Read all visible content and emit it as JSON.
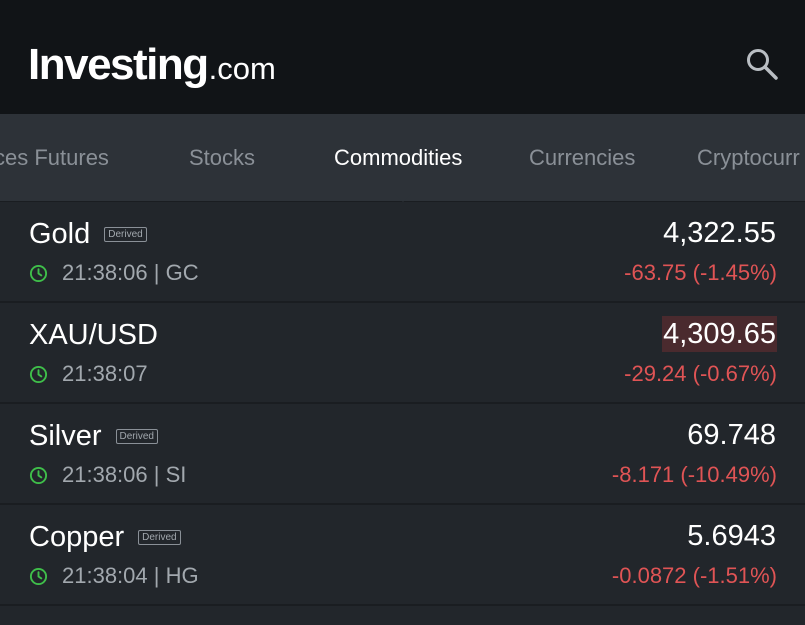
{
  "header": {
    "logo_main": "Investing",
    "logo_suffix": ".com",
    "search_icon": "search-icon"
  },
  "tabs": [
    {
      "label": "ces Futures"
    },
    {
      "label": "Stocks"
    },
    {
      "label": "Commodities",
      "active": true
    },
    {
      "label": "Currencies"
    },
    {
      "label": "Cryptocurr"
    }
  ],
  "rows": [
    {
      "name": "Gold",
      "badge": "Derived",
      "time": "21:38:06 | GC",
      "price": "4,322.55",
      "change": "-63.75 (-1.45%)"
    },
    {
      "name": "XAU/USD",
      "badge": "",
      "time": "21:38:07",
      "price": "4,309.65",
      "change": "-29.24 (-0.67%)"
    },
    {
      "name": "Silver",
      "badge": "Derived",
      "time": "21:38:06 | SI",
      "price": "69.748",
      "change": "-8.171 (-10.49%)"
    },
    {
      "name": "Copper",
      "badge": "Derived",
      "time": "21:38:04 | HG",
      "price": "5.6943",
      "change": "-0.0872 (-1.51%)"
    }
  ],
  "colors": {
    "header_bg": "#111417",
    "tab_bg": "#2d3238",
    "list_bg": "#22262b",
    "negative": "#e05455",
    "clock": "#3fbf4a"
  }
}
